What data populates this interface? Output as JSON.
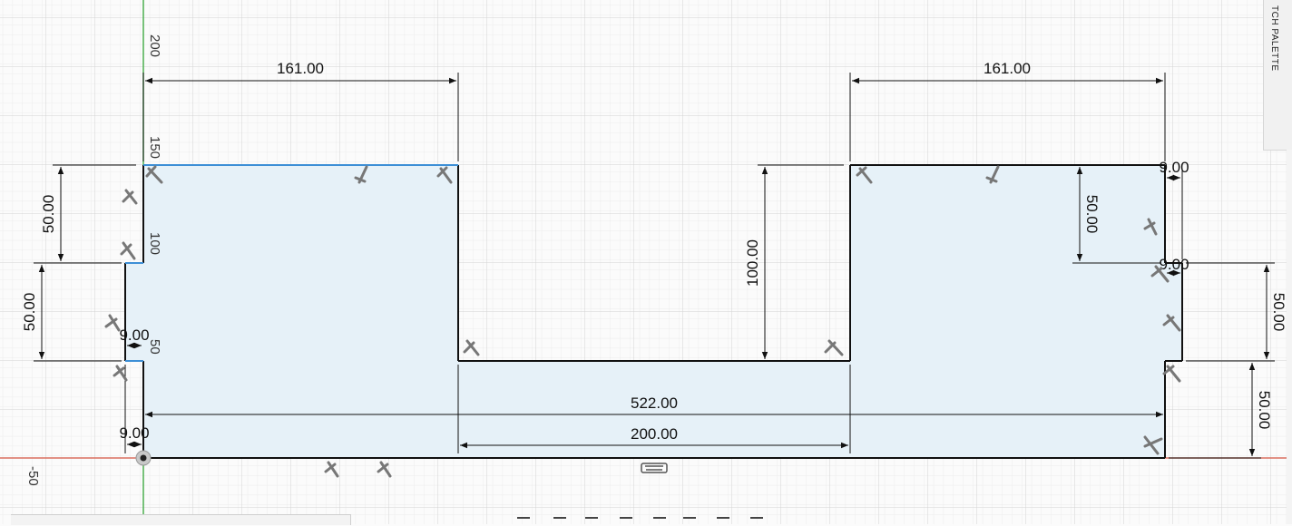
{
  "palette": {
    "label": "TCH PALETTE"
  },
  "axes": {
    "y_labels": [
      "200",
      "150",
      "100",
      "50"
    ],
    "x_labels": [
      "-50"
    ]
  },
  "dimensions": {
    "top_left_width": "161.00",
    "top_right_width": "161.00",
    "left_upper_height": "50.00",
    "left_lower_height": "50.00",
    "left_notch_width": "9.00",
    "bottom_left_offset": "9.00",
    "center_depth": "100.00",
    "right_inner_height": "50.00",
    "right_top_offset": "9.00",
    "right_mid_offset": "9.00",
    "right_outer_upper_height": "50.00",
    "right_outer_lower_height": "50.00",
    "overall_width": "522.00",
    "slot_width": "200.00"
  },
  "colors": {
    "fill": "#e6f1f8",
    "outline": "#111111",
    "selected_edge": "#3d8fd6",
    "x_axis": "#d9705f",
    "y_axis": "#4caf50",
    "grid_major": "#dcdcdc",
    "grid_minor": "#eeeeee"
  }
}
